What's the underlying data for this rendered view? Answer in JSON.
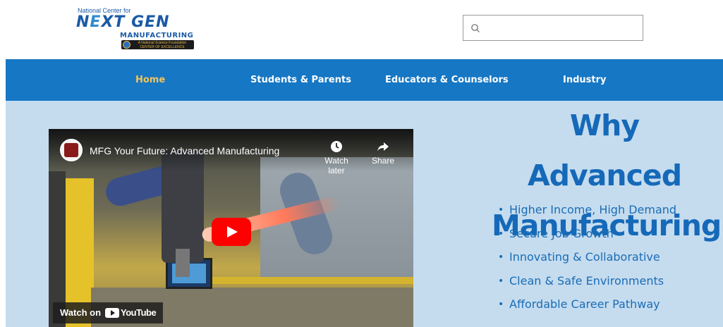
{
  "logo": {
    "line1": "National Center for",
    "line2_a": "N",
    "line2_x": "E",
    "line2_b": "XT GEN",
    "line3": "MANUFACTURING",
    "badge": "A National Science Foundation CENTER OF EXCELLENCE"
  },
  "search": {
    "placeholder": "",
    "value": "",
    "icon": "search-icon"
  },
  "nav": {
    "items": [
      {
        "label": "Home",
        "active": true
      },
      {
        "label": "Students & Parents",
        "active": false
      },
      {
        "label": "Educators & Counselors",
        "active": false
      },
      {
        "label": "Industry",
        "active": false
      }
    ]
  },
  "video": {
    "title": "MFG Your Future: Advanced Manufacturing",
    "watch_later": "Watch later",
    "share": "Share",
    "watch_on": "Watch on",
    "youtube": "YouTube"
  },
  "main": {
    "heading_line1": "Why Advanced",
    "heading_line2": "Manufacturing?",
    "bullets": [
      "Higher Income, High Demand",
      "Secure Job Growth",
      "Innovating & Collaborative",
      "Clean & Safe Environments",
      "Affordable Career Pathway"
    ]
  },
  "colors": {
    "nav_bg": "#1677c4",
    "nav_active": "#f3c35a",
    "main_bg": "#c5dcef",
    "heading": "#1569b8"
  }
}
